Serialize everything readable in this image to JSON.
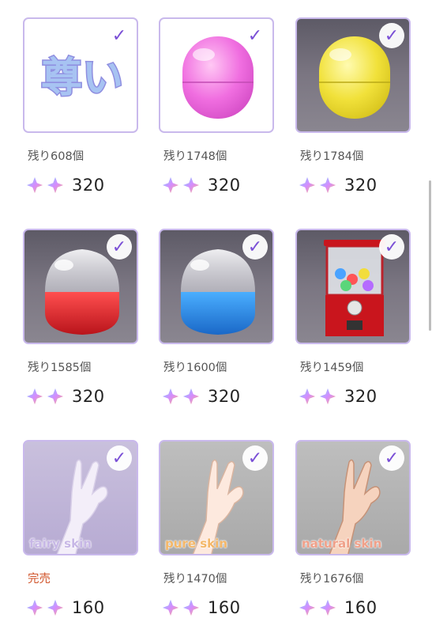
{
  "items": [
    {
      "remain": "残り608個",
      "price": "320",
      "art": "尊い"
    },
    {
      "remain": "残り1748個",
      "price": "320"
    },
    {
      "remain": "残り1784個",
      "price": "320"
    },
    {
      "remain": "残り1585個",
      "price": "320"
    },
    {
      "remain": "残り1600個",
      "price": "320"
    },
    {
      "remain": "残り1459個",
      "price": "320"
    },
    {
      "remain": "完売",
      "price": "160",
      "label": "fairy skin"
    },
    {
      "remain": "残り1470個",
      "price": "160",
      "label": "pure skin"
    },
    {
      "remain": "残り1676個",
      "price": "160",
      "label": "natural skin"
    }
  ],
  "colors": {
    "accent": "#7a4fd6",
    "border": "#c9b9ec",
    "sold": "#d1542a"
  },
  "icons": {
    "check": "check-icon",
    "gem": "gem-icon"
  }
}
